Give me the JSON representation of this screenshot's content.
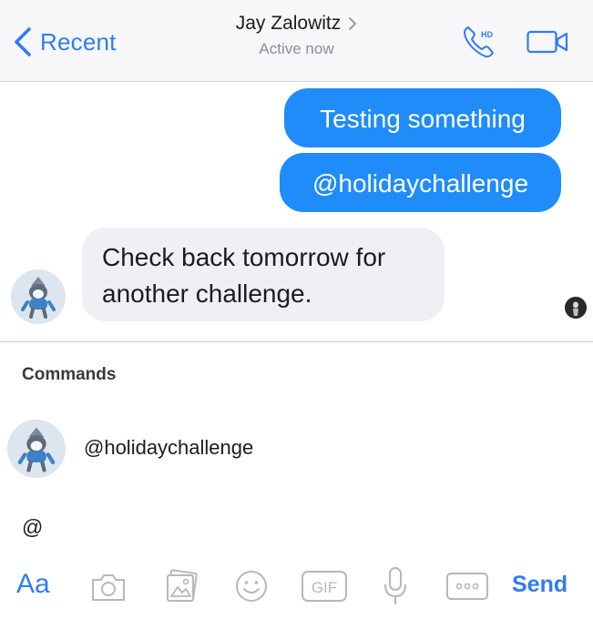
{
  "header": {
    "back_label": "Recent",
    "contact_name": "Jay Zalowitz",
    "status": "Active now",
    "phone_badge": "HD",
    "accent": "#2f7cf6"
  },
  "messages": [
    {
      "direction": "outgoing",
      "text": "Testing something"
    },
    {
      "direction": "outgoing",
      "text": "@holidaychallenge"
    },
    {
      "direction": "incoming",
      "text": "Check back tomorrow for another challenge."
    }
  ],
  "commands": {
    "heading": "Commands",
    "items": [
      {
        "label": "@holidaychallenge",
        "icon": "bot-avatar"
      }
    ]
  },
  "composer": {
    "value": "@"
  },
  "toolbar": {
    "text_label": "Aa",
    "gif_label": "GIF",
    "send_label": "Send",
    "icons": [
      "camera-icon",
      "photo-icon",
      "emoji-icon",
      "gif-icon",
      "microphone-icon",
      "more-icon"
    ]
  },
  "colors": {
    "outgoing_bubble": "#1f8cf9",
    "incoming_bubble": "#eef0f3"
  }
}
